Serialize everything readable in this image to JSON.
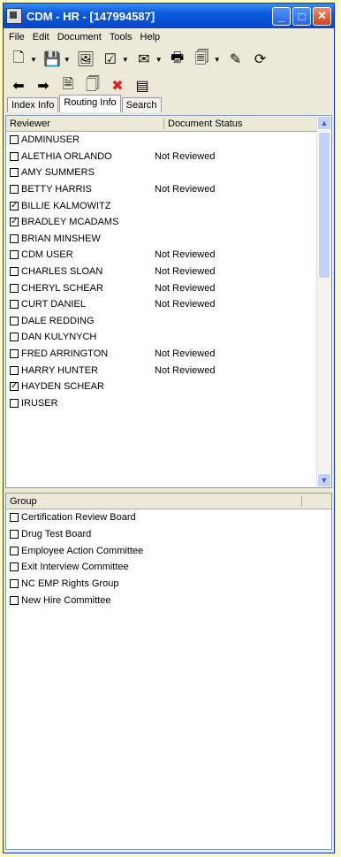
{
  "title": "CDM - HR - [147994587]",
  "titlebar_buttons": {
    "minimize": "_",
    "maximize": "□",
    "close": "✕"
  },
  "menu": [
    "File",
    "Edit",
    "Document",
    "Tools",
    "Help"
  ],
  "tabs": [
    "Index Info",
    "Routing Info",
    "Search"
  ],
  "reviewers": {
    "headers": [
      "Reviewer",
      "Document Status"
    ],
    "rows": [
      {
        "name": "ADMINUSER",
        "status": "",
        "checked": false
      },
      {
        "name": "ALETHIA ORLANDO",
        "status": "Not Reviewed",
        "checked": false
      },
      {
        "name": "AMY SUMMERS",
        "status": "",
        "checked": false
      },
      {
        "name": "BETTY HARRIS",
        "status": "Not Reviewed",
        "checked": false
      },
      {
        "name": "BILLIE KALMOWITZ",
        "status": "",
        "checked": true
      },
      {
        "name": "BRADLEY MCADAMS",
        "status": "",
        "checked": true
      },
      {
        "name": "BRIAN MINSHEW",
        "status": "",
        "checked": false
      },
      {
        "name": "CDM USER",
        "status": "Not Reviewed",
        "checked": false
      },
      {
        "name": "CHARLES SLOAN",
        "status": "Not Reviewed",
        "checked": false
      },
      {
        "name": "CHERYL SCHEAR",
        "status": "Not Reviewed",
        "checked": false
      },
      {
        "name": "CURT DANIEL",
        "status": "Not Reviewed",
        "checked": false
      },
      {
        "name": "DALE  REDDING",
        "status": "",
        "checked": false
      },
      {
        "name": "DAN KULYNYCH",
        "status": "",
        "checked": false
      },
      {
        "name": "FRED ARRINGTON",
        "status": "Not Reviewed",
        "checked": false
      },
      {
        "name": "HARRY HUNTER",
        "status": "Not Reviewed",
        "checked": false
      },
      {
        "name": "HAYDEN SCHEAR",
        "status": "",
        "checked": true
      },
      {
        "name": "IRUSER",
        "status": "",
        "checked": false
      }
    ]
  },
  "groups": {
    "header": "Group",
    "rows": [
      {
        "name": "Certification Review Board",
        "checked": false
      },
      {
        "name": "Drug Test Board",
        "checked": false
      },
      {
        "name": "Employee Action Committee",
        "checked": false
      },
      {
        "name": "Exit Interview Committee",
        "checked": false
      },
      {
        "name": "NC EMP Rights Group",
        "checked": false
      },
      {
        "name": "New Hire Committee",
        "checked": false
      }
    ]
  }
}
